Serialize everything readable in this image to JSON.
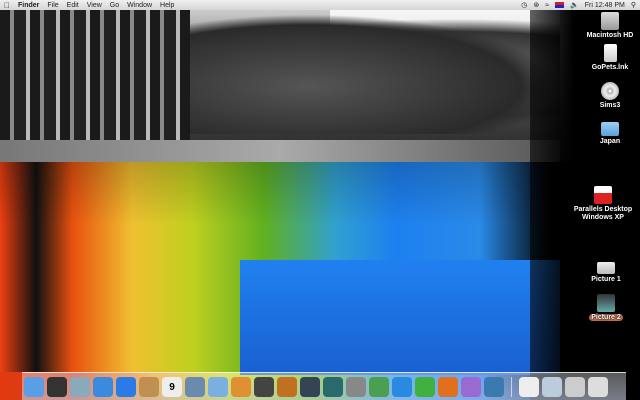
{
  "menubar": {
    "app": "Finder",
    "items": [
      "File",
      "Edit",
      "View",
      "Go",
      "Window",
      "Help"
    ],
    "clock": "Fri 12:48 PM"
  },
  "desktop_icons": [
    {
      "label": "Macintosh HD",
      "type": "hd"
    },
    {
      "label": "GoPets.lnk",
      "type": "doc"
    },
    {
      "label": "Sims3",
      "type": "cd"
    },
    {
      "label": "Japan",
      "type": "folder"
    },
    {
      "label": "Parallels Desktop",
      "label2": "Windows XP",
      "type": "pdoc"
    },
    {
      "label": "Picture 1",
      "type": "pic"
    },
    {
      "label": "Picture 2",
      "type": "pic2",
      "selected": true
    }
  ],
  "dock": {
    "calendar_day": "9",
    "apps": [
      {
        "name": "finder",
        "color": "#5a9ee8"
      },
      {
        "name": "dashboard",
        "color": "#333"
      },
      {
        "name": "mail",
        "color": "#8ab"
      },
      {
        "name": "safari",
        "color": "#3a8ae0"
      },
      {
        "name": "ichat",
        "color": "#2a7ae8"
      },
      {
        "name": "address-book",
        "color": "#c09050"
      },
      {
        "name": "ical",
        "color": "#eee"
      },
      {
        "name": "iphoto",
        "color": "#6a8ab0"
      },
      {
        "name": "itunes",
        "color": "#7ab0e0"
      },
      {
        "name": "image-capture",
        "color": "#e09030"
      },
      {
        "name": "imovie",
        "color": "#444"
      },
      {
        "name": "garageband",
        "color": "#c07020"
      },
      {
        "name": "spaces",
        "color": "#345"
      },
      {
        "name": "time-machine",
        "color": "#2a6a6a"
      },
      {
        "name": "system-preferences",
        "color": "#888"
      },
      {
        "name": "messenger",
        "color": "#4aa050"
      },
      {
        "name": "word",
        "color": "#2a8ae0"
      },
      {
        "name": "excel",
        "color": "#40b040"
      },
      {
        "name": "powerpoint",
        "color": "#e07020"
      },
      {
        "name": "entourage",
        "color": "#9a6ad0"
      },
      {
        "name": "parallels",
        "color": "#3a7ab0"
      }
    ],
    "right": [
      {
        "name": "document",
        "color": "#eee"
      },
      {
        "name": "downloads",
        "color": "#bcd"
      },
      {
        "name": "window-preview",
        "color": "#ccc"
      },
      {
        "name": "trash",
        "color": "#ddd"
      }
    ]
  }
}
